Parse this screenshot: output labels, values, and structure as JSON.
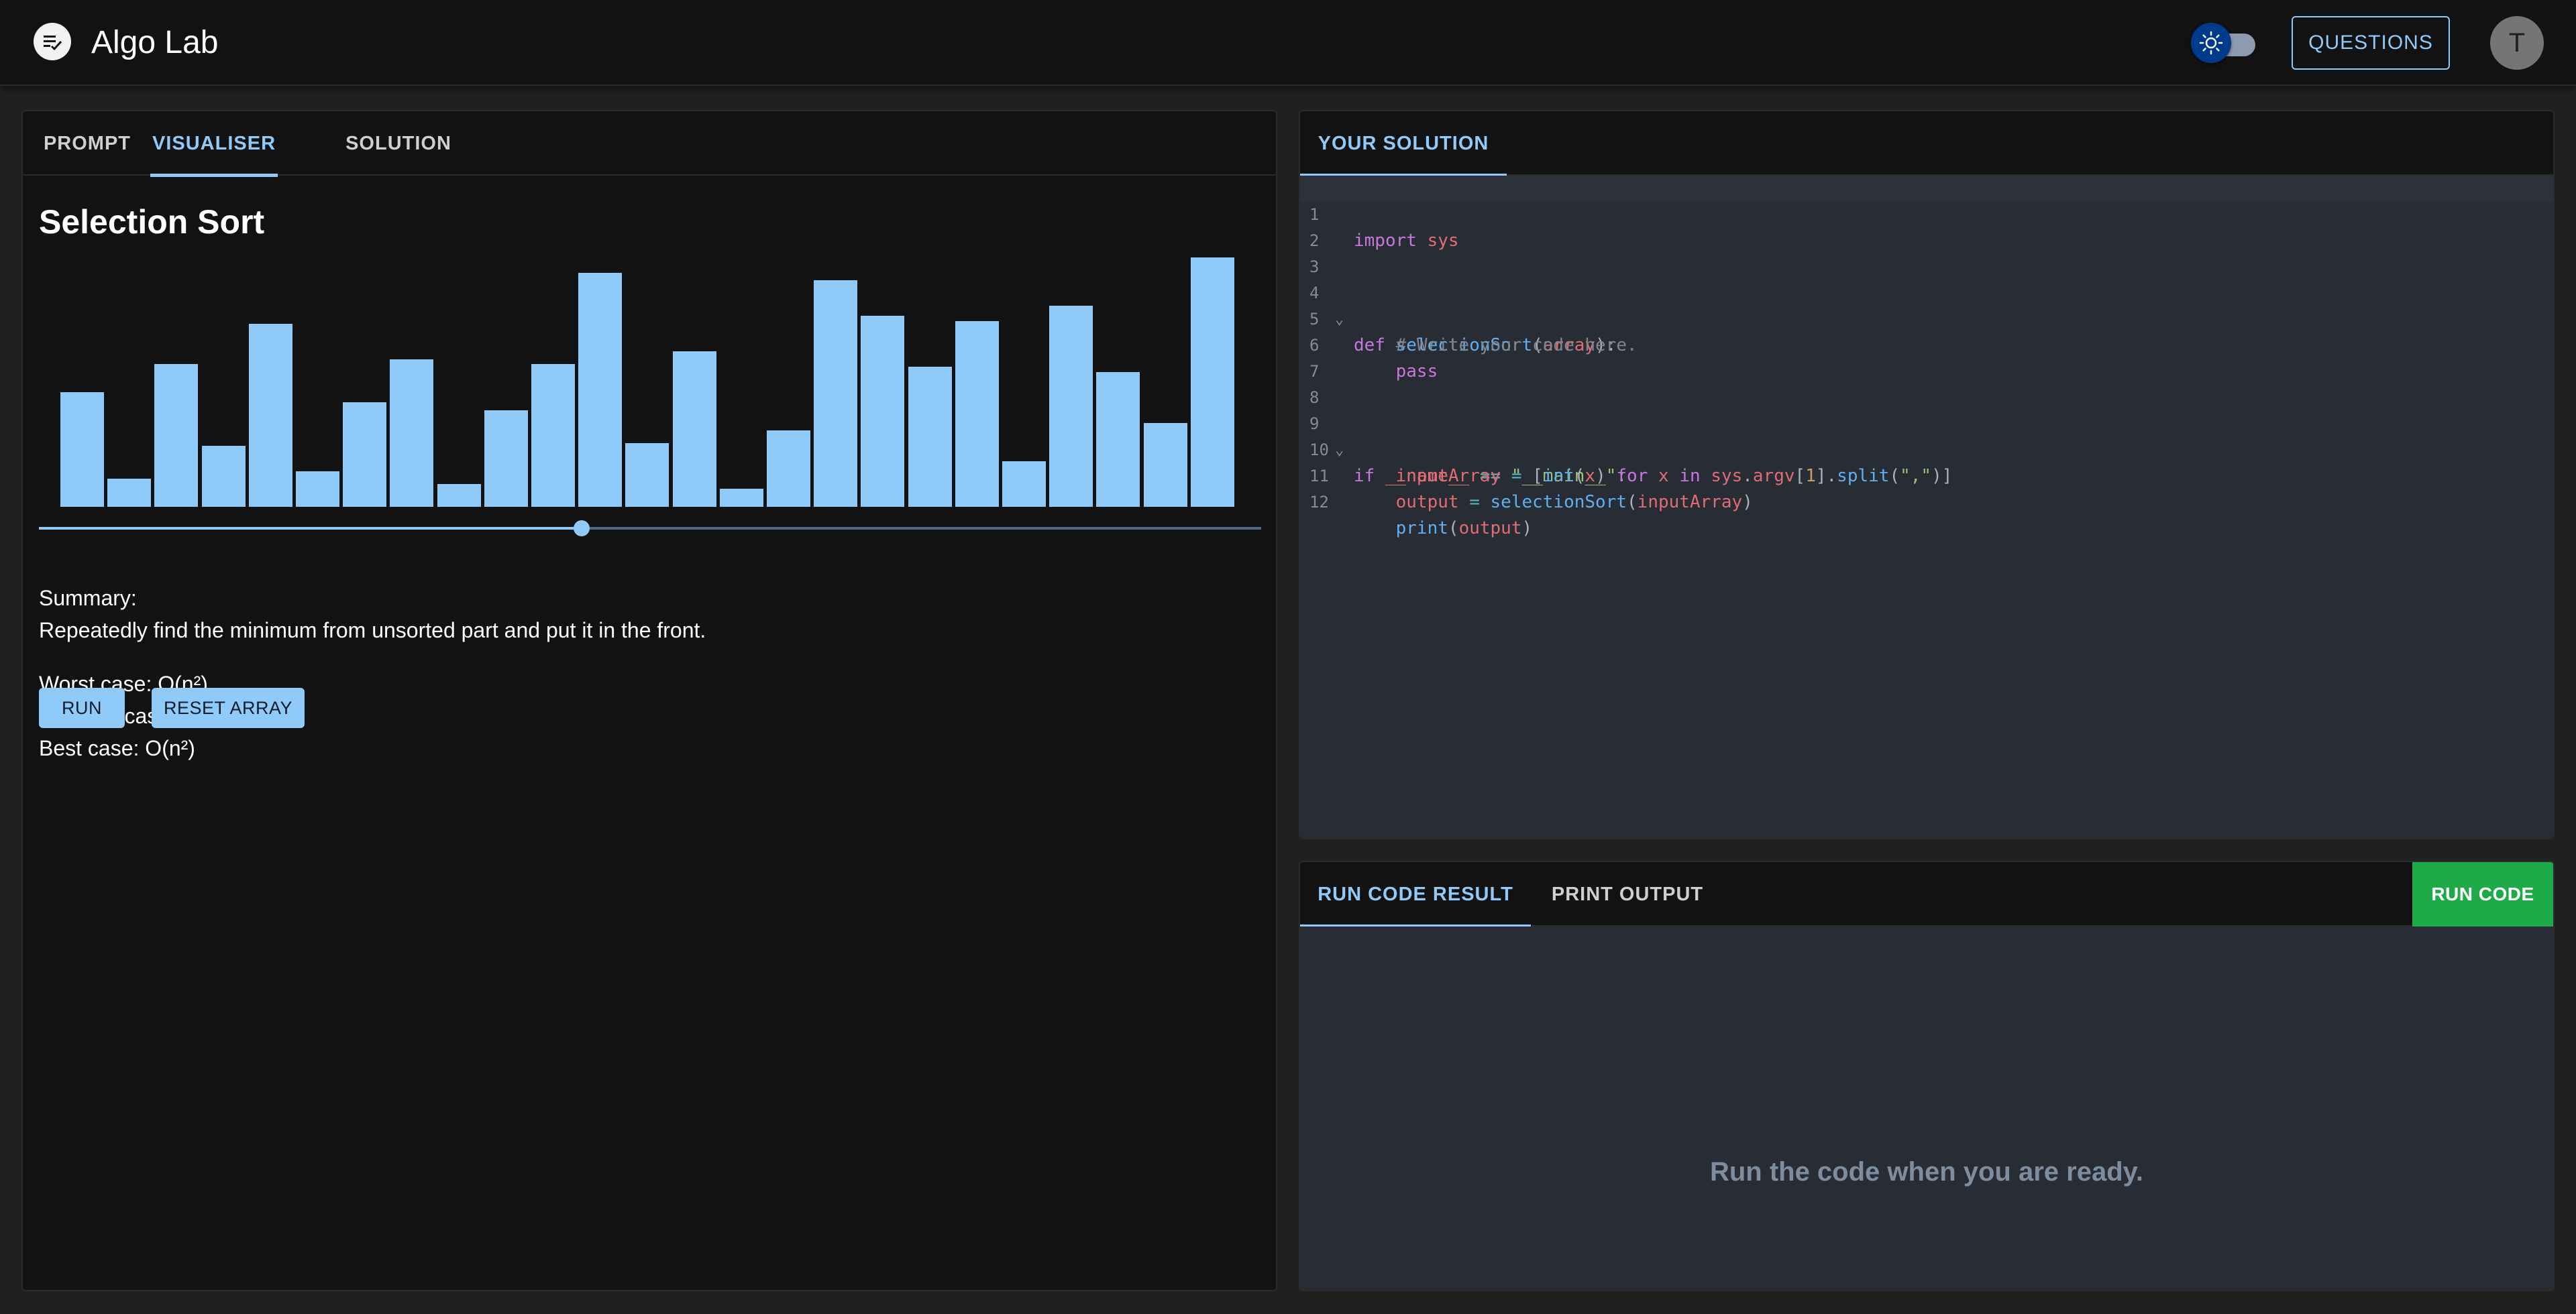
{
  "header": {
    "app_title": "Algo Lab",
    "questions_label": "QUESTIONS",
    "avatar_initial": "T",
    "theme_toggle_icon": "sun-icon"
  },
  "left_panel": {
    "tabs": [
      {
        "label": "PROMPT",
        "active": false
      },
      {
        "label": "VISUALISER",
        "active": true
      },
      {
        "label": "SOLUTION",
        "active": false
      }
    ],
    "title": "Selection Sort",
    "bar_values": [
      45,
      11,
      56,
      24,
      72,
      14,
      41,
      58,
      9,
      38,
      56,
      92,
      25,
      61,
      7,
      30,
      89,
      75,
      55,
      73,
      18,
      79,
      53,
      33,
      98
    ],
    "slider_value_fraction": 0.444,
    "summary_heading": "Summary:",
    "summary_text": "Repeatedly find the minimum from unsorted part and put it in the front.",
    "worst_case": "Worst case: O(n²)",
    "average_case": "Average case: O(n²)",
    "best_case": "Best case: O(n²)",
    "run_label": "RUN",
    "reset_label": "RESET ARRAY",
    "accent_color": "#90caf9"
  },
  "code_panel": {
    "tab_label": "YOUR SOLUTION",
    "line_numbers": [
      "1",
      "2",
      "3",
      "4",
      "5",
      "6",
      "7",
      "8",
      "9",
      "10",
      "11",
      "12"
    ],
    "code_lines": [
      "import sys",
      "",
      "",
      "def selectionSort(array):",
      "    # Write your code here.",
      "    pass",
      "",
      "",
      "if __name__ == \"__main__\":",
      "    inputArray = [int(x) for x in sys.argv[1].split(\",\")]",
      "    output = selectionSort(inputArray)",
      "    print(output)"
    ]
  },
  "result_panel": {
    "tabs": [
      {
        "label": "RUN CODE RESULT",
        "active": true
      },
      {
        "label": "PRINT OUTPUT",
        "active": false
      }
    ],
    "run_code_label": "RUN CODE",
    "message": "Run the code when you are ready.",
    "run_button_color": "#1faa4a"
  }
}
